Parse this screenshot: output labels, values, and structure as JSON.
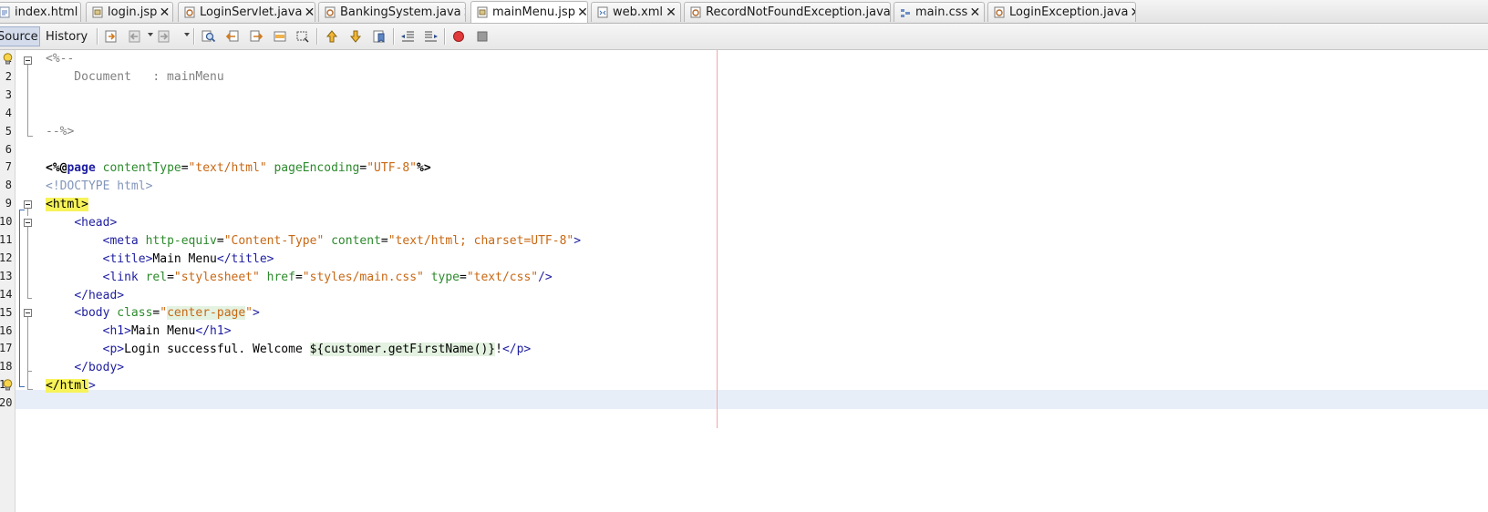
{
  "tabs": [
    {
      "label": "index.html",
      "icon": "html-file-icon",
      "active": false
    },
    {
      "label": "login.jsp",
      "icon": "jsp-file-icon",
      "active": false
    },
    {
      "label": "LoginServlet.java",
      "icon": "java-file-icon",
      "active": false
    },
    {
      "label": "BankingSystem.java",
      "icon": "java-file-icon",
      "active": false
    },
    {
      "label": "mainMenu.jsp",
      "icon": "jsp-file-icon",
      "active": true
    },
    {
      "label": "web.xml",
      "icon": "xml-file-icon",
      "active": false
    },
    {
      "label": "RecordNotFoundException.java",
      "icon": "java-file-icon",
      "active": false
    },
    {
      "label": "main.css",
      "icon": "css-file-icon",
      "active": false
    },
    {
      "label": "LoginException.java",
      "icon": "java-file-icon",
      "active": false
    }
  ],
  "close_glyph": "✕",
  "editor_toolbar": {
    "source_tab": "Source",
    "history_tab": "History",
    "buttons": [
      "last-edit-icon",
      "back-icon",
      "forward-icon",
      "find-selection-icon",
      "find-previous-icon",
      "find-next-icon",
      "toggle-highlight-icon",
      "toggle-rectangular-selection-icon",
      "previous-bookmark-icon",
      "next-bookmark-icon",
      "toggle-bookmark-icon",
      "shift-left-icon",
      "shift-right-icon",
      "start-macro-recording-icon",
      "stop-macro-recording-icon"
    ]
  },
  "colors": {
    "tag": "#1e1ea0",
    "attribute": "#2c8a2c",
    "value": "#c86814",
    "comment": "#808080",
    "doctype": "#8296bb",
    "match_highlight": "#f7f35a",
    "current_line": "#e8eef8",
    "right_margin": "#f2a8a8"
  },
  "gutter": {
    "line_numbers": [
      "1",
      "2",
      "3",
      "4",
      "5",
      "6",
      "7",
      "8",
      "9",
      "10",
      "11",
      "12",
      "13",
      "14",
      "15",
      "16",
      "17",
      "18",
      "19",
      "20"
    ],
    "hint_lines": [
      1,
      19
    ]
  },
  "code": {
    "l1": {
      "comment": "<%--"
    },
    "l2": {
      "comment": "    Document   : mainMenu"
    },
    "l5": {
      "comment": "--%>"
    },
    "l7": {
      "open": "<%@",
      "directive": "page",
      "attr1": "contentType",
      "eq1": "=",
      "val1": "\"text/html\"",
      "attr2": "pageEncoding",
      "eq2": "=",
      "val2": "\"UTF-8\"",
      "close": "%>"
    },
    "l8": {
      "doctype": "<!DOCTYPE html>"
    },
    "l9": {
      "tag": "<html>"
    },
    "l10": {
      "tag": "<head>"
    },
    "l11": {
      "tag_open": "<meta",
      "attr1": "http-equiv",
      "eq1": "=",
      "val1": "\"Content-Type\"",
      "attr2": "content",
      "eq2": "=",
      "val2": "\"text/html; charset=UTF-8\"",
      "tag_close": ">"
    },
    "l12": {
      "tag_open": "<title>",
      "text": "Main Menu",
      "tag_close": "</title>"
    },
    "l13": {
      "tag_open": "<link",
      "attr1": "rel",
      "eq1": "=",
      "val1": "\"stylesheet\"",
      "attr2": "href",
      "eq2": "=",
      "val2": "\"styles/main.css\"",
      "attr3": "type",
      "eq3": "=",
      "val3": "\"text/css\"",
      "tag_close": "/>"
    },
    "l14": {
      "tag": "</head>"
    },
    "l15": {
      "tag_open": "<body",
      "attr1": "class",
      "eq1": "=",
      "quote": "\"",
      "val1": "center-page",
      "tag_close": ">"
    },
    "l16": {
      "tag_open": "<h1>",
      "text": "Main Menu",
      "tag_close": "</h1>"
    },
    "l17": {
      "tag_open": "<p>",
      "text": "Login successful. Welcome ",
      "el": "${customer.getFirstName()}",
      "text2": "!",
      "tag_close": "</p>"
    },
    "l18": {
      "tag": "</body>"
    },
    "l19": {
      "tag_hl": "</html",
      "tag_end": ">"
    }
  }
}
